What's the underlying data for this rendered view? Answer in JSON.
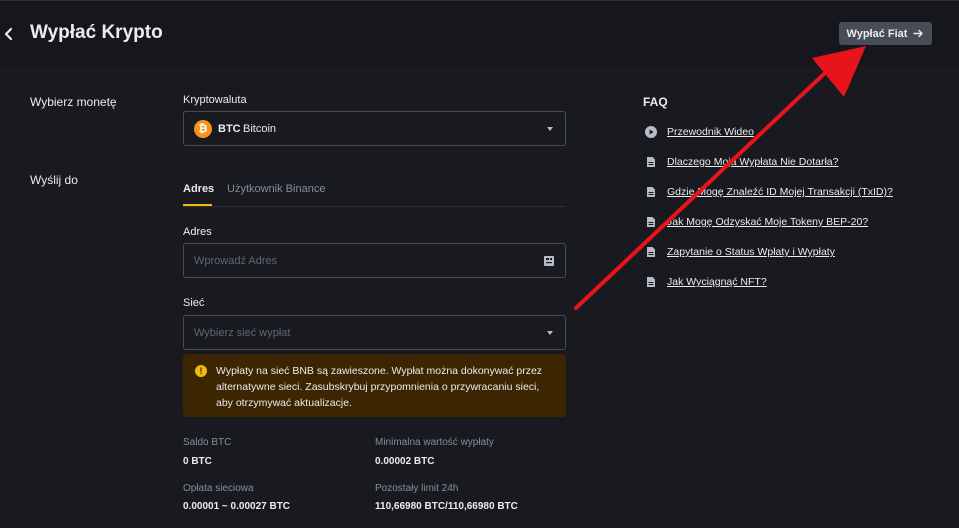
{
  "header": {
    "title": "Wypłać Krypto",
    "fiat_button_label": "Wypłać Fiat"
  },
  "labels": {
    "select_coin": "Wybierz monetę",
    "send_to": "Wyślij do"
  },
  "coin": {
    "field_label": "Kryptowaluta",
    "icon_glyph": "₿",
    "symbol": "BTC",
    "name": "Bitcoin",
    "icon_color": "#f7931a"
  },
  "tabs": [
    {
      "label": "Adres",
      "active": true
    },
    {
      "label": "Użytkownik Binance",
      "active": false
    }
  ],
  "address": {
    "field_label": "Adres",
    "placeholder": "Wprowadź Adres"
  },
  "network": {
    "field_label": "Sieć",
    "placeholder": "Wybierz sieć wypłat"
  },
  "warning": {
    "icon_glyph": "!",
    "text": "Wypłaty na sieć BNB są zawieszone. Wypłat można dokonywać przez alternatywne sieci. Zasubskrybuj przypomnienia o przywracaniu sieci, aby otrzymywać aktualizacje."
  },
  "info": {
    "balance_label": "Saldo BTC",
    "balance_value": "0 BTC",
    "min_label": "Minimalna wartość wypłaty",
    "min_value": "0.00002 BTC",
    "fee_label": "Opłata sieciowa",
    "fee_value": "0.00001 ~ 0.00027 BTC",
    "limit_label": "Pozostały limit 24h",
    "limit_value": "110,66980 BTC/110,66980 BTC"
  },
  "faq": {
    "title": "FAQ",
    "items": [
      {
        "icon": "play-icon",
        "label": "Przewodnik Wideo"
      },
      {
        "icon": "document-icon",
        "label": "Dlaczego Moja Wypłata Nie Dotarła?"
      },
      {
        "icon": "document-icon",
        "label": "Gdzie Mogę Znaleźć ID Mojej Transakcji (TxID)?"
      },
      {
        "icon": "document-icon",
        "label": "Jak Mogę Odzyskać Moje Tokeny BEP-20?"
      },
      {
        "icon": "document-icon",
        "label": "Zapytanie o Status Wpłaty i Wypłaty"
      },
      {
        "icon": "document-icon",
        "label": "Jak Wyciągnąć NFT?"
      }
    ]
  },
  "colors": {
    "accent": "#f0b90b",
    "annotation": "#e8141b",
    "warning_bg": "#3c2601"
  }
}
